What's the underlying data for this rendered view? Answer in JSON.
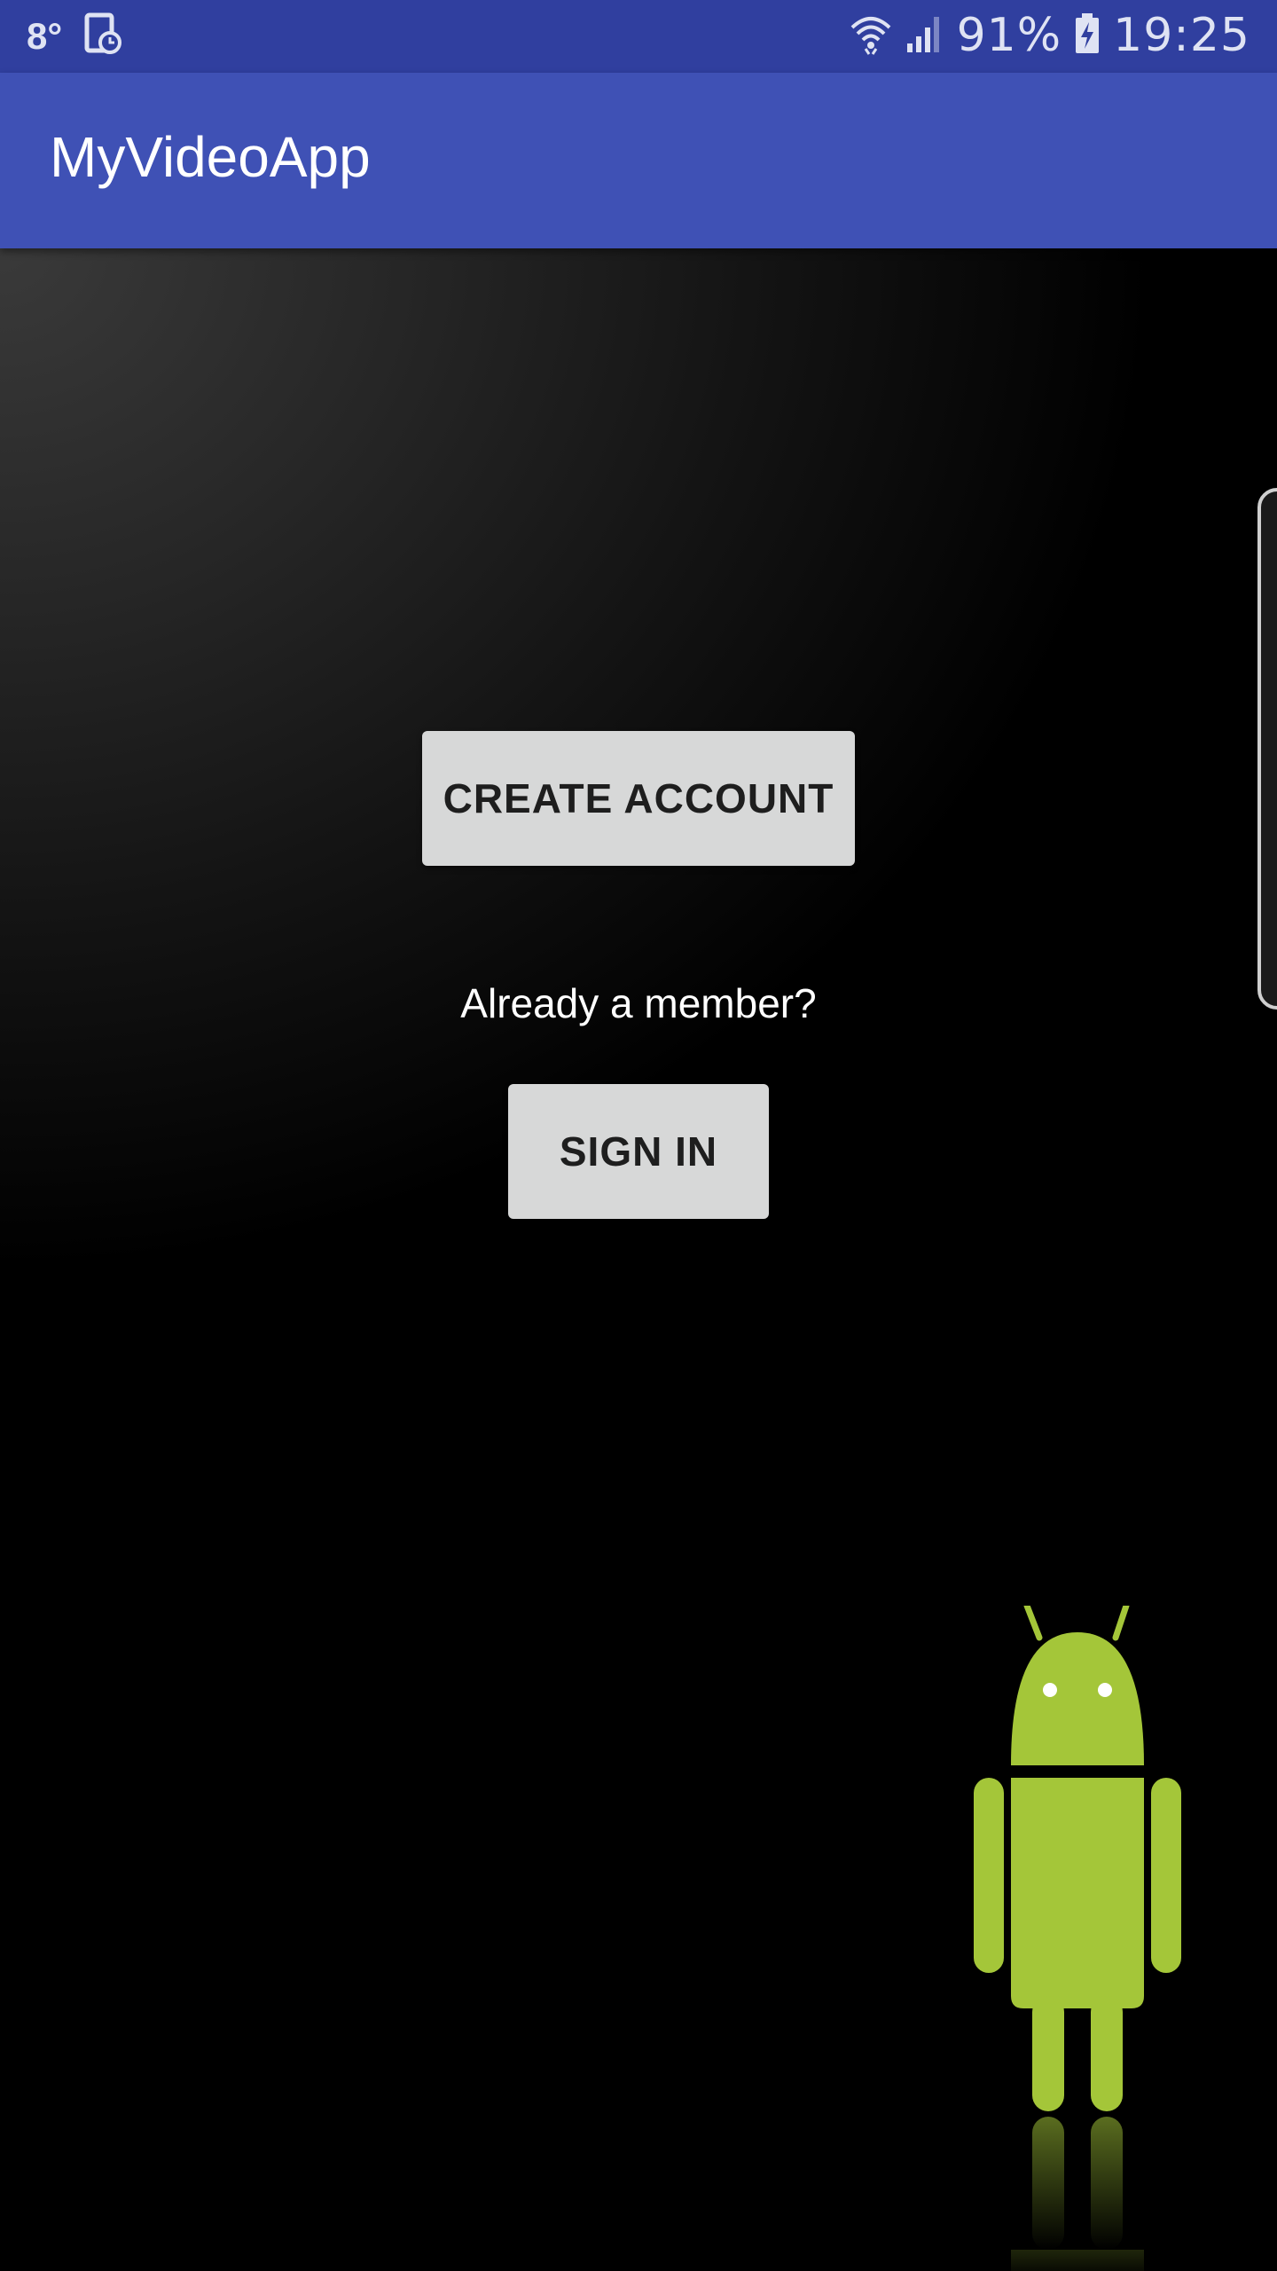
{
  "status_bar": {
    "temperature": "8°",
    "battery_percent": "91%",
    "time": "19:25",
    "icons": [
      "tablet-clock-icon",
      "wifi-icon",
      "signal-icon",
      "battery-charging-icon"
    ]
  },
  "app_bar": {
    "title": "MyVideoApp"
  },
  "main": {
    "create_account_label": "CREATE ACCOUNT",
    "member_prompt": "Already a member?",
    "sign_in_label": "SIGN IN"
  },
  "colors": {
    "status_bar": "#303f9f",
    "app_bar": "#3f51b5",
    "button": "#d7d8d8",
    "android_green": "#a4c639"
  }
}
